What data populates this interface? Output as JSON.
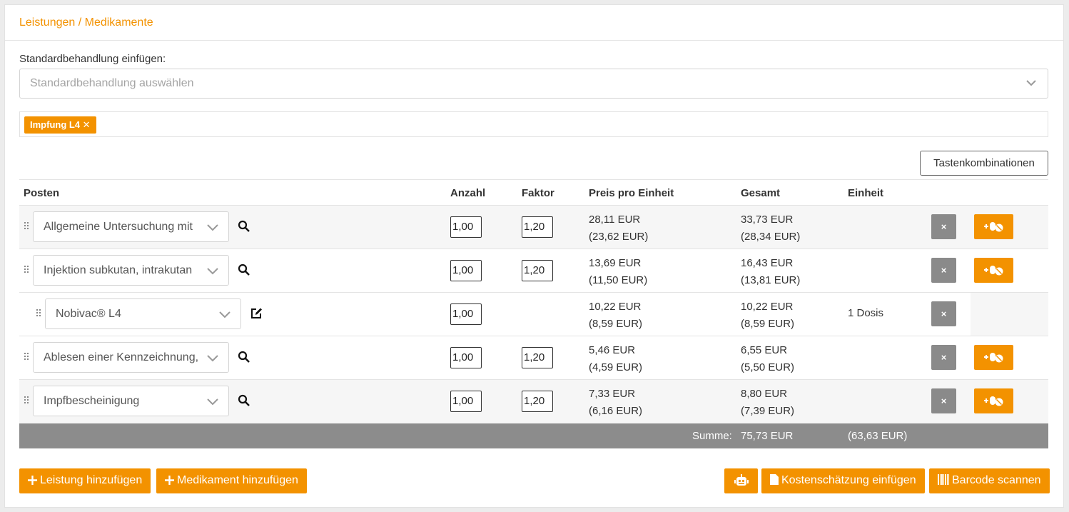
{
  "panel": {
    "title": "Leistungen / Medikamente"
  },
  "standard": {
    "label": "Standardbehandlung einfügen:",
    "placeholder": "Standardbehandlung auswählen",
    "tags": [
      "Impfung L4"
    ]
  },
  "shortcuts_button": "Tastenkombinationen",
  "table": {
    "headers": {
      "posten": "Posten",
      "anzahl": "Anzahl",
      "faktor": "Faktor",
      "preis": "Preis pro Einheit",
      "gesamt": "Gesamt",
      "einheit": "Einheit"
    },
    "rows": [
      {
        "name": "Allgemeine Untersuchung mit",
        "anzahl": "1,00",
        "faktor": "1,20",
        "preis": "28,11 EUR",
        "preis_netto": "(23,62 EUR)",
        "gesamt": "33,73 EUR",
        "gesamt_netto": "(28,34 EUR)",
        "einheit": ""
      },
      {
        "name": "Injektion subkutan, intrakutan",
        "anzahl": "1,00",
        "faktor": "1,20",
        "preis": "13,69 EUR",
        "preis_netto": "(11,50 EUR)",
        "gesamt": "16,43 EUR",
        "gesamt_netto": "(13,81 EUR)",
        "einheit": ""
      },
      {
        "name": "Nobivac® L4",
        "anzahl": "1,00",
        "faktor": "",
        "preis": "10,22 EUR",
        "preis_netto": "(8,59 EUR)",
        "gesamt": "10,22 EUR",
        "gesamt_netto": "(8,59 EUR)",
        "einheit": "1 Dosis"
      },
      {
        "name": "Ablesen einer Kennzeichnung,",
        "anzahl": "1,00",
        "faktor": "1,20",
        "preis": "5,46 EUR",
        "preis_netto": "(4,59 EUR)",
        "gesamt": "6,55 EUR",
        "gesamt_netto": "(5,50 EUR)",
        "einheit": ""
      },
      {
        "name": "Impfbescheinigung",
        "anzahl": "1,00",
        "faktor": "1,20",
        "preis": "7,33 EUR",
        "preis_netto": "(6,16 EUR)",
        "gesamt": "8,80 EUR",
        "gesamt_netto": "(7,39 EUR)",
        "einheit": ""
      }
    ],
    "delete_label": "×",
    "sum": {
      "label": "Summe:",
      "gross": "75,73 EUR",
      "net": "(63,63 EUR)"
    }
  },
  "footer": {
    "add_service": "Leistung hinzufügen",
    "add_medication": "Medikament hinzufügen",
    "insert_estimate": "Kostenschätzung einfügen",
    "scan_barcode": "Barcode scannen"
  },
  "colors": {
    "accent": "#f39200",
    "delete_button": "#8a8a8a",
    "sum_bar": "#8c8c8c"
  }
}
